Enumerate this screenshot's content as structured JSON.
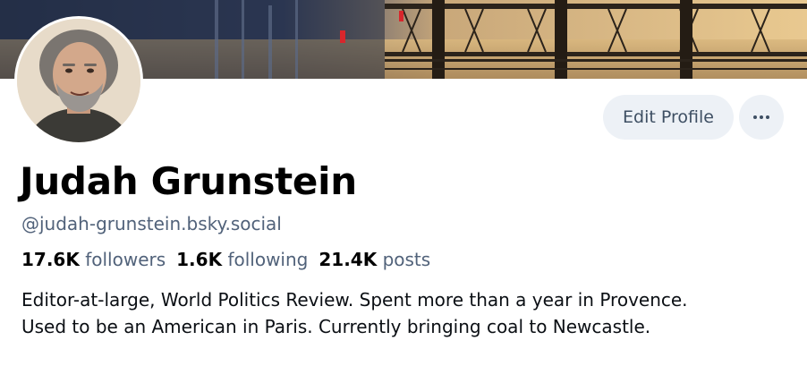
{
  "profile": {
    "display_name": "Judah Grunstein",
    "handle": "@judah-grunstein.bsky.social",
    "avatar_alt": "Profile photo of Judah Grunstein",
    "banner_alt": "Banner photo of a bridge over water at sunset"
  },
  "actions": {
    "edit_profile_label": "Edit Profile",
    "more_icon": "more-horizontal-icon"
  },
  "stats": {
    "followers_count": "17.6K",
    "followers_label": "followers",
    "following_count": "1.6K",
    "following_label": "following",
    "posts_count": "21.4K",
    "posts_label": "posts"
  },
  "bio": {
    "line1": "Editor-at-large, World Politics Review. Spent more than a year in Provence.",
    "line2": "Used to be an American in Paris. Currently bringing coal to Newcastle."
  },
  "colors": {
    "button_bg": "#edf1f6",
    "button_text": "#3e4f63",
    "secondary_text": "#51627a"
  }
}
